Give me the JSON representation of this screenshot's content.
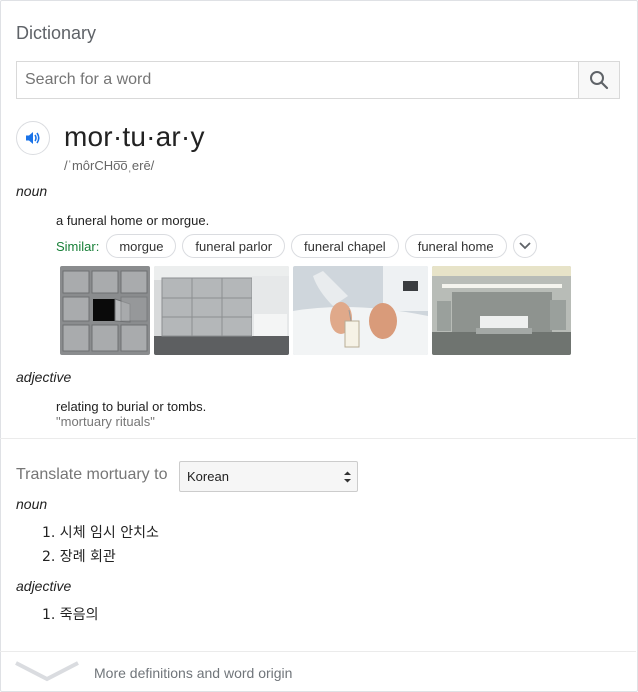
{
  "title": "Dictionary",
  "search": {
    "placeholder": "Search for a word",
    "value": ""
  },
  "entry": {
    "word": "mor·tu·ar·y",
    "phonetic": "/ˈmôrCHo͞oˌerē/"
  },
  "noun_section": {
    "pos": "noun",
    "definition": "a funeral home or morgue.",
    "similar_label": "Similar:",
    "similar_chips": [
      "morgue",
      "funeral parlor",
      "funeral chapel",
      "funeral home"
    ]
  },
  "adjective_section": {
    "pos": "adjective",
    "definition": "relating to burial or tombs.",
    "example": "\"mortuary rituals\""
  },
  "translate": {
    "label": "Translate mortuary to",
    "language": "Korean",
    "noun_pos": "noun",
    "noun_items": [
      "1. 시체 임시 안치소",
      "2. 장례 회관"
    ],
    "adjective_pos": "adjective",
    "adjective_items": [
      "1. 죽음의"
    ]
  },
  "footer": {
    "more_label": "More definitions and word origin"
  },
  "colors": {
    "accent_blue": "#1a73e8",
    "similar_green": "#188038"
  }
}
